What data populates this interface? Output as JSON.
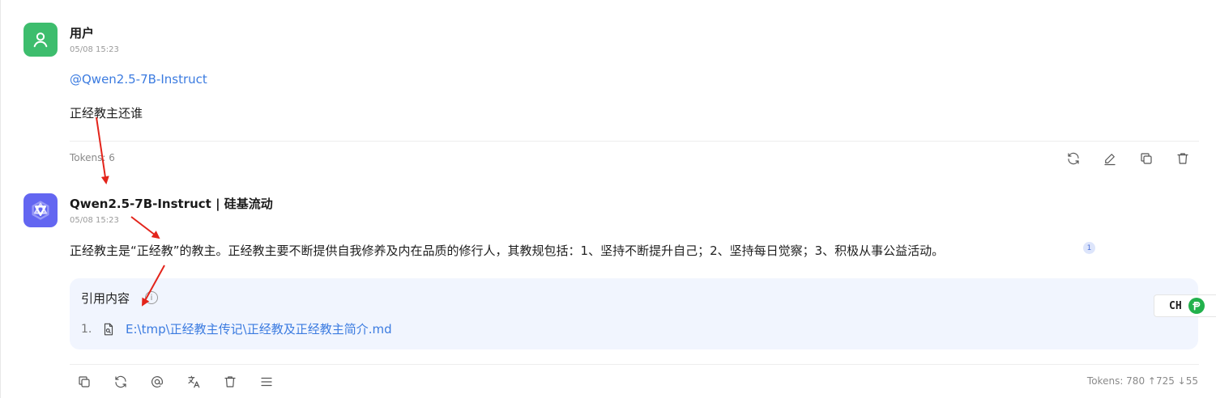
{
  "user_message": {
    "sender": "用户",
    "time": "05/08 15:23",
    "mention": "@Qwen2.5-7B-Instruct",
    "text": "正经教主还谁",
    "tokens": "Tokens: 6",
    "actions": [
      {
        "name": "regenerate",
        "icon": "refresh-icon"
      },
      {
        "name": "edit",
        "icon": "pencil-icon"
      },
      {
        "name": "copy",
        "icon": "copy-icon"
      },
      {
        "name": "delete",
        "icon": "trash-icon"
      }
    ]
  },
  "assistant_message": {
    "sender": "Qwen2.5-7B-Instruct | 硅基流动",
    "time": "05/08 15:23",
    "text": "正经教主是“正经教”的教主。正经教主要不断提供自我修养及内在品质的修行人，其教规包括：1、坚持不断提升自己；2、坚持每日觉察；3、积极从事公益活动。",
    "citation_marker": "1",
    "references": {
      "title": "引用内容",
      "info_glyph": "i",
      "items": [
        {
          "index": "1.",
          "path": "E:\\tmp\\正经教主传记\\正经教及正经教主简介.md"
        }
      ]
    },
    "tokens": "Tokens: 780 ↑725 ↓55",
    "actions": [
      {
        "name": "copy",
        "icon": "copy-icon"
      },
      {
        "name": "regenerate",
        "icon": "refresh-icon"
      },
      {
        "name": "mention",
        "icon": "at-icon"
      },
      {
        "name": "translate",
        "icon": "translate-icon"
      },
      {
        "name": "delete",
        "icon": "trash-icon"
      },
      {
        "name": "more",
        "icon": "menu-icon"
      }
    ]
  },
  "input_widget": {
    "label": "CH"
  },
  "colors": {
    "user_avatar": "#3dbd6d",
    "assistant_avatar": "#6366f1",
    "link": "#3b7be0",
    "reference_bg": "#f1f5fe",
    "annotation_arrow": "#e3241b"
  }
}
